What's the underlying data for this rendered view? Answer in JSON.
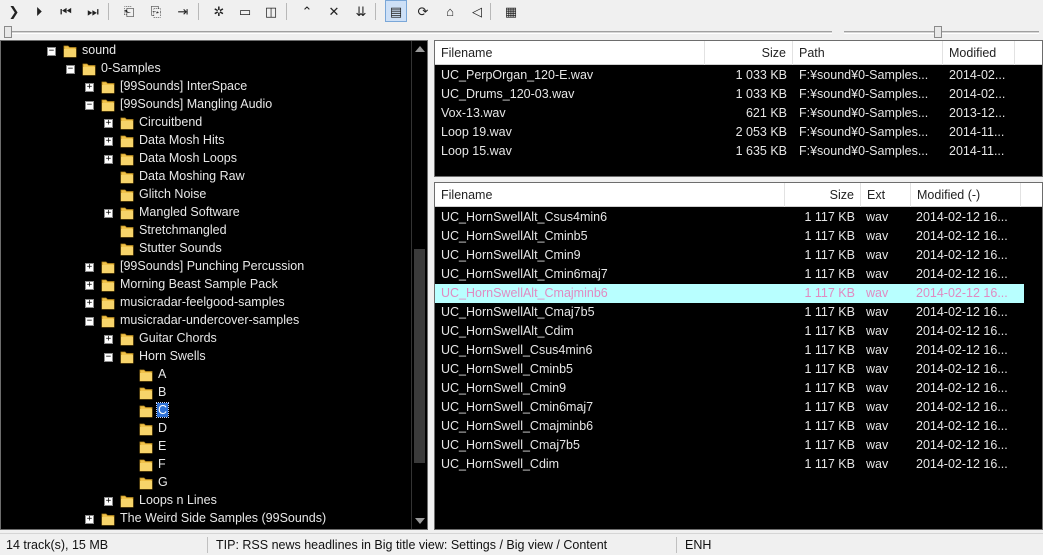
{
  "toolbar": {
    "buttons": [
      {
        "name": "play-icon",
        "glyph": "❯"
      },
      {
        "name": "play-pause-icon",
        "glyph": "⏵"
      },
      {
        "name": "previous-track-icon",
        "glyph": "⏮"
      },
      {
        "name": "next-track-icon",
        "glyph": "⏭"
      },
      {
        "name": "folder-back-icon",
        "glyph": "⎗"
      },
      {
        "name": "folder-forward-icon",
        "glyph": "⎘"
      },
      {
        "name": "jump-to-icon",
        "glyph": "⇥"
      },
      {
        "name": "settings-gear-icon",
        "glyph": "✲"
      },
      {
        "name": "mini-view-icon",
        "glyph": "▭"
      },
      {
        "name": "sidebar-toggle-icon",
        "glyph": "◫"
      },
      {
        "name": "move-up-icon",
        "glyph": "⌃"
      },
      {
        "name": "remove-icon",
        "glyph": "✕"
      },
      {
        "name": "sort-down-icon",
        "glyph": "⇊"
      },
      {
        "name": "layout-split-icon",
        "glyph": "▤"
      },
      {
        "name": "refresh-icon",
        "glyph": "⟳"
      },
      {
        "name": "home-icon",
        "glyph": "⌂"
      },
      {
        "name": "volume-icon",
        "glyph": "◁"
      },
      {
        "name": "playlist-view-icon",
        "glyph": "▦"
      }
    ]
  },
  "tree": {
    "nodes": [
      {
        "label": "sound",
        "level": 0,
        "expander": "−",
        "selected": false
      },
      {
        "label": "0-Samples",
        "level": 1,
        "expander": "−",
        "selected": false
      },
      {
        "label": "[99Sounds] InterSpace",
        "level": 2,
        "expander": "+",
        "selected": false
      },
      {
        "label": "[99Sounds] Mangling Audio",
        "level": 2,
        "expander": "−",
        "selected": false
      },
      {
        "label": "Circuitbend",
        "level": 3,
        "expander": "+",
        "selected": false
      },
      {
        "label": "Data Mosh Hits",
        "level": 3,
        "expander": "+",
        "selected": false
      },
      {
        "label": "Data Mosh Loops",
        "level": 3,
        "expander": "+",
        "selected": false
      },
      {
        "label": "Data Moshing Raw",
        "level": 3,
        "expander": "",
        "selected": false
      },
      {
        "label": "Glitch Noise",
        "level": 3,
        "expander": "",
        "selected": false
      },
      {
        "label": "Mangled Software",
        "level": 3,
        "expander": "+",
        "selected": false
      },
      {
        "label": "Stretchmangled",
        "level": 3,
        "expander": "",
        "selected": false
      },
      {
        "label": "Stutter Sounds",
        "level": 3,
        "expander": "",
        "selected": false
      },
      {
        "label": "[99Sounds] Punching Percussion",
        "level": 2,
        "expander": "+",
        "selected": false
      },
      {
        "label": "Morning Beast Sample Pack",
        "level": 2,
        "expander": "+",
        "selected": false
      },
      {
        "label": "musicradar-feelgood-samples",
        "level": 2,
        "expander": "+",
        "selected": false
      },
      {
        "label": "musicradar-undercover-samples",
        "level": 2,
        "expander": "−",
        "selected": false
      },
      {
        "label": "Guitar Chords",
        "level": 3,
        "expander": "+",
        "selected": false
      },
      {
        "label": "Horn Swells",
        "level": 3,
        "expander": "−",
        "selected": false
      },
      {
        "label": "A",
        "level": 4,
        "expander": "",
        "selected": false
      },
      {
        "label": "B",
        "level": 4,
        "expander": "",
        "selected": false
      },
      {
        "label": "C",
        "level": 4,
        "expander": "",
        "selected": true
      },
      {
        "label": "D",
        "level": 4,
        "expander": "",
        "selected": false
      },
      {
        "label": "E",
        "level": 4,
        "expander": "",
        "selected": false
      },
      {
        "label": "F",
        "level": 4,
        "expander": "",
        "selected": false
      },
      {
        "label": "G",
        "level": 4,
        "expander": "",
        "selected": false
      },
      {
        "label": "Loops n Lines",
        "level": 3,
        "expander": "+",
        "selected": false
      },
      {
        "label": "The Weird Side Samples (99Sounds)",
        "level": 2,
        "expander": "+",
        "selected": false
      }
    ]
  },
  "recent": {
    "columns": {
      "filename": "Filename",
      "size": "Size",
      "path": "Path",
      "modified": "Modified"
    },
    "rows": [
      {
        "filename": "UC_PerpOrgan_120-E.wav",
        "size": "1 033 KB",
        "path": "F:¥sound¥0-Samples...",
        "modified": "2014-02..."
      },
      {
        "filename": "UC_Drums_120-03.wav",
        "size": "1 033 KB",
        "path": "F:¥sound¥0-Samples...",
        "modified": "2014-02..."
      },
      {
        "filename": "Vox-13.wav",
        "size": "621 KB",
        "path": "F:¥sound¥0-Samples...",
        "modified": "2013-12..."
      },
      {
        "filename": "Loop 19.wav",
        "size": "2 053 KB",
        "path": "F:¥sound¥0-Samples...",
        "modified": "2014-11..."
      },
      {
        "filename": "Loop 15.wav",
        "size": "1 635 KB",
        "path": "F:¥sound¥0-Samples...",
        "modified": "2014-11..."
      }
    ]
  },
  "files": {
    "columns": {
      "filename": "Filename",
      "size": "Size",
      "ext": "Ext",
      "modified": "Modified (-)"
    },
    "rows": [
      {
        "filename": "UC_HornSwellAlt_Csus4min6",
        "size": "1 117 KB",
        "ext": "wav",
        "modified": "2014-02-12 16...",
        "highlight": false
      },
      {
        "filename": "UC_HornSwellAlt_Cminb5",
        "size": "1 117 KB",
        "ext": "wav",
        "modified": "2014-02-12 16...",
        "highlight": false
      },
      {
        "filename": "UC_HornSwellAlt_Cmin9",
        "size": "1 117 KB",
        "ext": "wav",
        "modified": "2014-02-12 16...",
        "highlight": false
      },
      {
        "filename": "UC_HornSwellAlt_Cmin6maj7",
        "size": "1 117 KB",
        "ext": "wav",
        "modified": "2014-02-12 16...",
        "highlight": false
      },
      {
        "filename": "UC_HornSwellAlt_Cmajminb6",
        "size": "1 117 KB",
        "ext": "wav",
        "modified": "2014-02-12 16...",
        "highlight": true
      },
      {
        "filename": "UC_HornSwellAlt_Cmaj7b5",
        "size": "1 117 KB",
        "ext": "wav",
        "modified": "2014-02-12 16...",
        "highlight": false
      },
      {
        "filename": "UC_HornSwellAlt_Cdim",
        "size": "1 117 KB",
        "ext": "wav",
        "modified": "2014-02-12 16...",
        "highlight": false
      },
      {
        "filename": "UC_HornSwell_Csus4min6",
        "size": "1 117 KB",
        "ext": "wav",
        "modified": "2014-02-12 16...",
        "highlight": false
      },
      {
        "filename": "UC_HornSwell_Cminb5",
        "size": "1 117 KB",
        "ext": "wav",
        "modified": "2014-02-12 16...",
        "highlight": false
      },
      {
        "filename": "UC_HornSwell_Cmin9",
        "size": "1 117 KB",
        "ext": "wav",
        "modified": "2014-02-12 16...",
        "highlight": false
      },
      {
        "filename": "UC_HornSwell_Cmin6maj7",
        "size": "1 117 KB",
        "ext": "wav",
        "modified": "2014-02-12 16...",
        "highlight": false
      },
      {
        "filename": "UC_HornSwell_Cmajminb6",
        "size": "1 117 KB",
        "ext": "wav",
        "modified": "2014-02-12 16...",
        "highlight": false
      },
      {
        "filename": "UC_HornSwell_Cmaj7b5",
        "size": "1 117 KB",
        "ext": "wav",
        "modified": "2014-02-12 16...",
        "highlight": false
      },
      {
        "filename": "UC_HornSwell_Cdim",
        "size": "1 117 KB",
        "ext": "wav",
        "modified": "2014-02-12 16...",
        "highlight": false
      }
    ]
  },
  "status": {
    "tracks": "14 track(s), 15 MB",
    "tip": "TIP: RSS news headlines in Big title view: Settings / Big view / Content",
    "ime": "ENH"
  },
  "colors": {
    "panel_bg": "#000000",
    "highlight_row": "#b8ffff",
    "highlight_text": "#e08bc2",
    "selection": "#3072d6",
    "folder": "#f0c24a"
  }
}
